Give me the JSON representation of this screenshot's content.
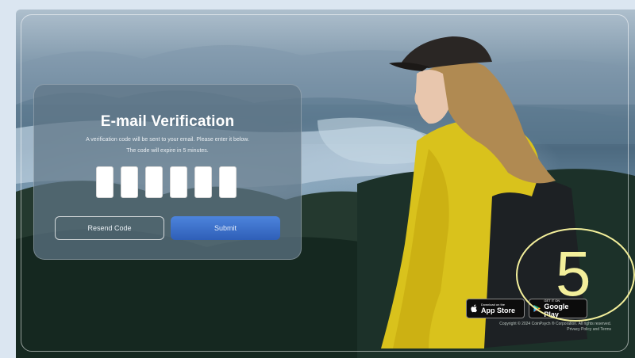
{
  "card": {
    "title": "E-mail Verification",
    "line1": "A verification code will be sent to your email. Please enter it below.",
    "line2": "The code will expire in 5 minutes.",
    "code_boxes": [
      "",
      "",
      "",
      "",
      "",
      ""
    ]
  },
  "buttons": {
    "resend_label": "Resend Code",
    "submit_label": "Submit"
  },
  "stores": {
    "apple_top": "Download on the",
    "apple_main": "App Store",
    "google_top": "GET IT ON",
    "google_main": "Google Play"
  },
  "footer": {
    "copyright": "Copyright © 2024 CoinPsych ® Corporation. All rights reserved.",
    "copyright2": "Privacy Policy and Terms"
  },
  "annotation": {
    "number": "5"
  },
  "colors": {
    "submit": "#3d6fcf",
    "annotation": "#f3ef9b",
    "card_bg": "#607686"
  }
}
